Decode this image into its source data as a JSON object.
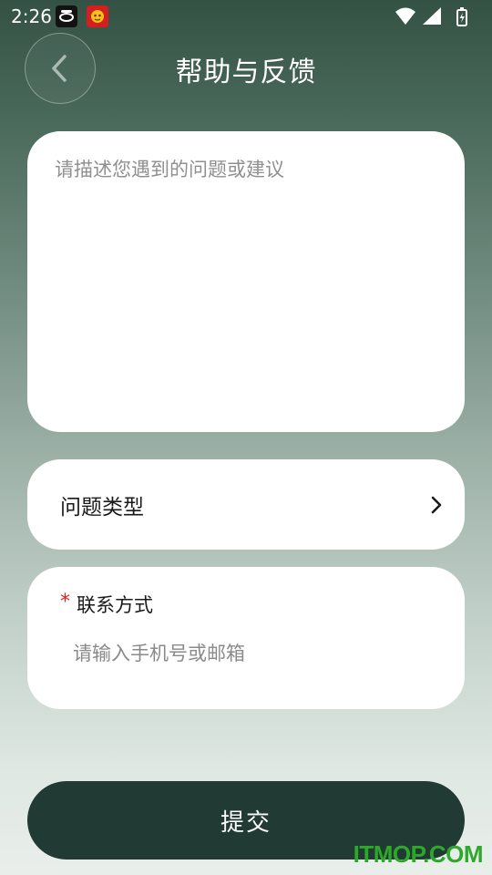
{
  "status_bar": {
    "time": "2:26",
    "icons": [
      "notification-app-icon",
      "notification-app-icon",
      "wifi-icon",
      "cellular-signal-icon",
      "battery-icon"
    ]
  },
  "header": {
    "back_icon": "chevron-left-icon",
    "title": "帮助与反馈"
  },
  "feedback": {
    "placeholder": "请描述您遇到的问题或建议",
    "value": ""
  },
  "issue_type": {
    "label": "问题类型",
    "chevron_icon": "chevron-right-icon"
  },
  "contact": {
    "required_mark": "*",
    "title": "联系方式",
    "placeholder": "请输入手机号或邮箱",
    "value": ""
  },
  "submit": {
    "label": "提交"
  },
  "watermark": {
    "text": "ITMOP.COM"
  },
  "colors": {
    "submit_bg": "#213a33",
    "required": "#e02020",
    "watermark": "#2ea82a",
    "gradient_top": "#345244",
    "gradient_bottom": "#e9eeeb"
  }
}
